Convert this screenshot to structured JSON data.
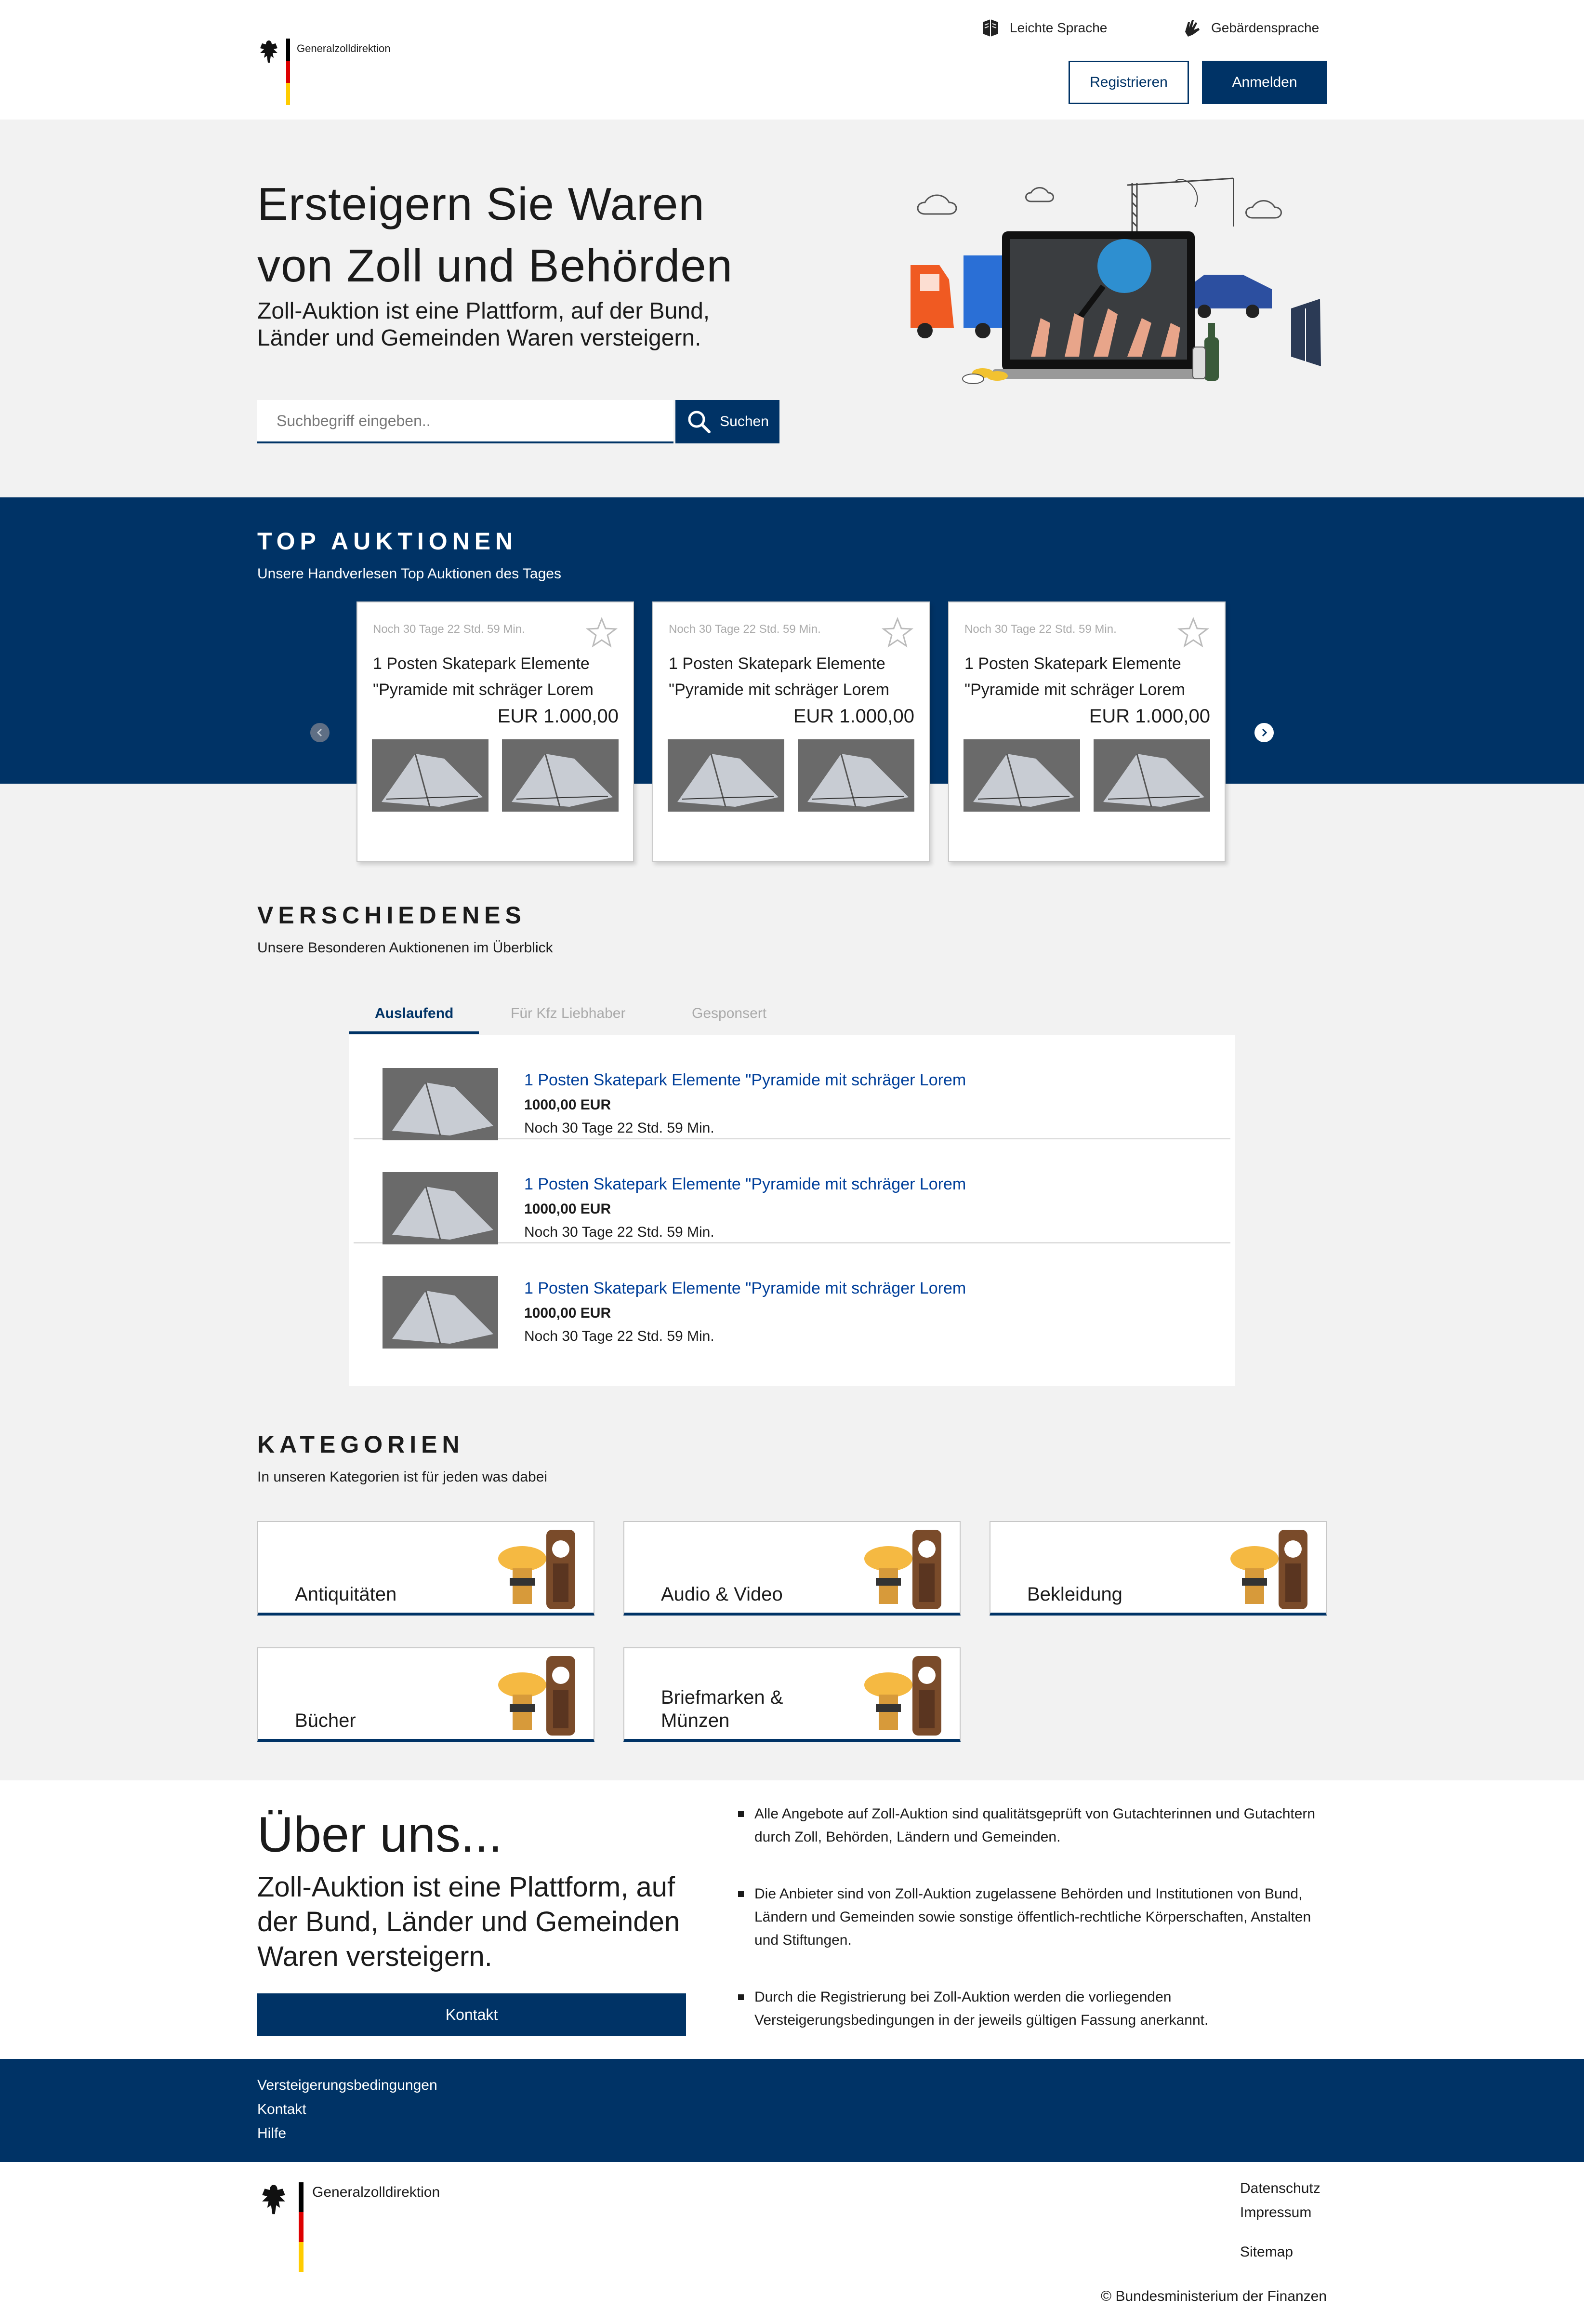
{
  "header": {
    "logo_text": "Generalzolldirektion",
    "easy_language": "Leichte Sprache",
    "sign_language": "Gebärdensprache",
    "register_label": "Registrieren",
    "login_label": "Anmelden"
  },
  "hero": {
    "title_line1": "Ersteigern Sie Waren",
    "title_line2": "von Zoll und Behörden",
    "subtitle": "Zoll-Auktion ist eine Plattform, auf der Bund, Länder und Gemeinden Waren versteigern.",
    "search_placeholder": "Suchbegriff eingeben..",
    "search_button": "Suchen"
  },
  "top_auctions": {
    "heading": "TOP AUKTIONEN",
    "subheading": "Unsere Handverlesen Top Auktionen des Tages",
    "cards": [
      {
        "timer": "Noch 30 Tage 22 Std. 59 Min.",
        "title": "1 Posten Skatepark Elemente \"Pyramide mit schräger Lorem",
        "price": "EUR 1.000,00"
      },
      {
        "timer": "Noch 30 Tage 22 Std. 59 Min.",
        "title": "1 Posten Skatepark Elemente \"Pyramide mit schräger Lorem",
        "price": "EUR 1.000,00"
      },
      {
        "timer": "Noch 30 Tage 22 Std. 59 Min.",
        "title": "1 Posten Skatepark Elemente \"Pyramide mit schräger Lorem",
        "price": "EUR 1.000,00"
      }
    ]
  },
  "various": {
    "heading": "VERSCHIEDENES",
    "subheading": "Unsere Besonderen Auktionenen im Überblick",
    "tabs": [
      "Auslaufend",
      "Für Kfz Liebhaber",
      "Gesponsert"
    ],
    "items": [
      {
        "title": "1 Posten Skatepark Elemente \"Pyramide mit schräger Lorem",
        "price": "1000,00 EUR",
        "time": "Noch 30 Tage 22 Std. 59 Min."
      },
      {
        "title": "1 Posten Skatepark Elemente \"Pyramide mit schräger Lorem",
        "price": "1000,00 EUR",
        "time": "Noch 30 Tage 22 Std. 59 Min."
      },
      {
        "title": "1 Posten Skatepark Elemente \"Pyramide mit schräger Lorem",
        "price": "1000,00 EUR",
        "time": "Noch 30 Tage 22 Std. 59 Min."
      }
    ]
  },
  "categories": {
    "heading": "KATEGORIEN",
    "subheading": "In unseren Kategorien ist für jeden was dabei",
    "items": [
      "Antiquitäten",
      "Audio & Video",
      "Bekleidung",
      "Bücher",
      "Briefmarken & Münzen"
    ]
  },
  "about": {
    "heading": "Über uns...",
    "subtitle": "Zoll-Auktion ist eine Plattform, auf der Bund, Länder und Gemeinden Waren versteigern.",
    "contact_button": "Kontakt",
    "bullets": [
      "Alle Angebote auf Zoll-Auktion sind qualitätsgeprüft von Gutachterinnen und Gutachtern durch Zoll, Behörden, Ländern und Gemeinden.",
      "Die Anbieter sind von Zoll-Auktion zugelassene Behörden und Institutionen von Bund, Ländern und Gemeinden sowie sonstige öffentlich-rechtliche Körperschaften, Anstalten und Stiftungen.",
      "Durch die Registrierung bei Zoll-Auktion werden die vorliegenden Versteigerungsbedingungen in der jeweils gültigen Fassung anerkannt."
    ]
  },
  "footer": {
    "links": [
      "Versteigerungsbedingungen",
      "Kontakt",
      "Hilfe"
    ],
    "logo_text": "Generalzolldirektion",
    "legal_links": [
      "Datenschutz",
      "Impressum",
      "Sitemap"
    ],
    "copyright": "© Bundesministerium der Finanzen"
  },
  "colors": {
    "brand_navy": "#003366",
    "link_blue": "#003f9a",
    "hero_bg": "#f2f2f2"
  }
}
